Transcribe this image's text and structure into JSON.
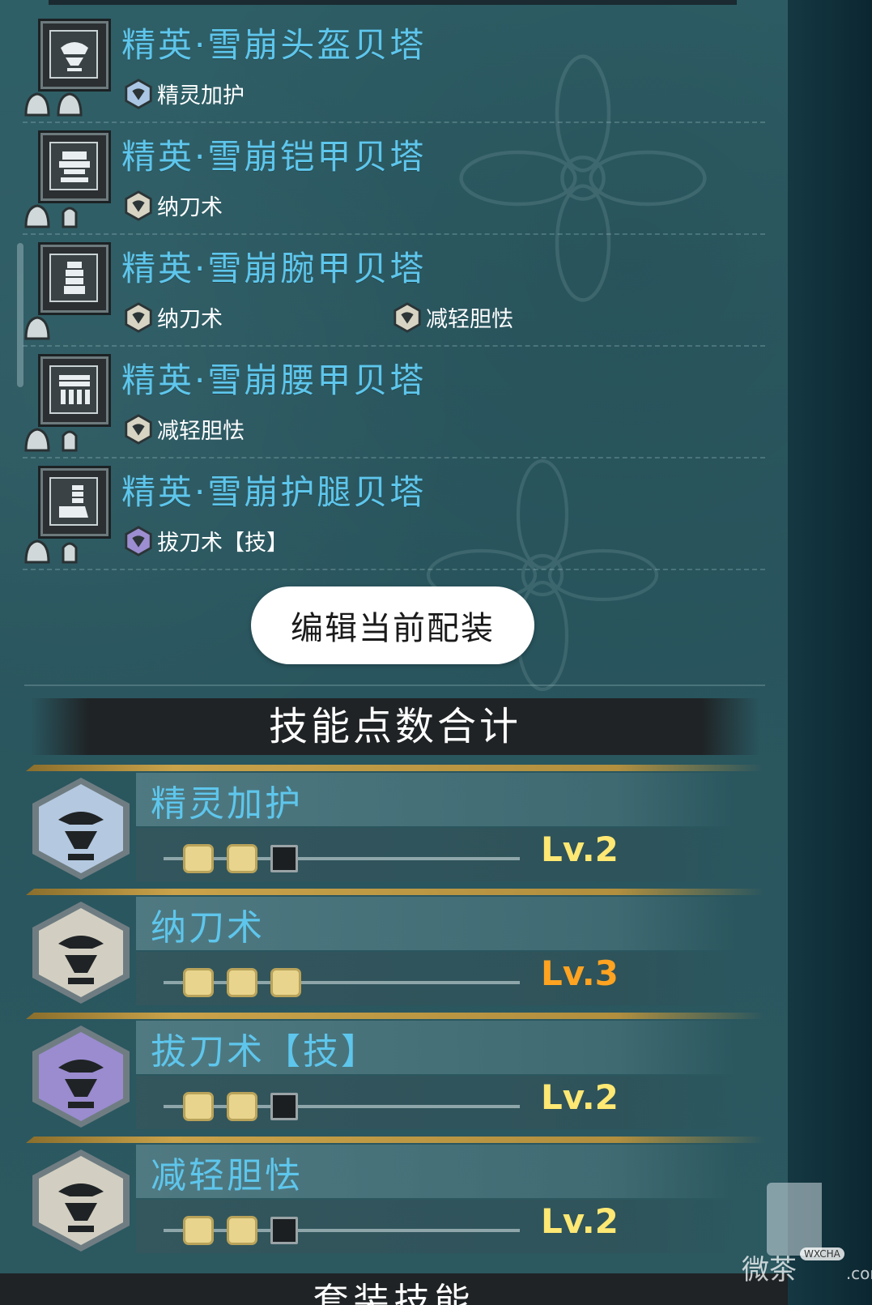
{
  "armor_list": [
    {
      "name": "精英·雪崩头盔贝塔",
      "slot_type": "helmet-icon",
      "slots": [
        "gem-slot-icon",
        "gem-slot-icon"
      ],
      "skills": [
        {
          "label": "精灵加护",
          "color": "#aac6e4"
        }
      ]
    },
    {
      "name": "精英·雪崩铠甲贝塔",
      "slot_type": "chest-armor-icon",
      "slots": [
        "gem-slot-icon",
        "small-slot-icon"
      ],
      "skills": [
        {
          "label": "纳刀术",
          "color": "#d8d4c4"
        }
      ]
    },
    {
      "name": "精英·雪崩腕甲贝塔",
      "slot_type": "gauntlet-icon",
      "slots": [
        "gem-slot-icon"
      ],
      "skills": [
        {
          "label": "纳刀术",
          "color": "#d8d4c4"
        },
        {
          "label": "减轻胆怯",
          "color": "#d8d4c4"
        }
      ]
    },
    {
      "name": "精英·雪崩腰甲贝塔",
      "slot_type": "waist-armor-icon",
      "slots": [
        "gem-slot-icon",
        "small-slot-icon"
      ],
      "skills": [
        {
          "label": "减轻胆怯",
          "color": "#d8d4c4"
        }
      ]
    },
    {
      "name": "精英·雪崩护腿贝塔",
      "slot_type": "leg-armor-icon",
      "slots": [
        "gem-slot-icon",
        "small-slot-icon"
      ],
      "skills": [
        {
          "label": "拔刀术【技】",
          "color": "#9c8ed0"
        }
      ]
    }
  ],
  "edit_button": {
    "label": "编辑当前配装"
  },
  "skill_section": {
    "title": "技能点数合计"
  },
  "skills_total": [
    {
      "name": "精灵加护",
      "level_text": "Lv.2",
      "level": 2,
      "max": 3,
      "badge_color": "#b4c8e0",
      "level_color": "#ffe873"
    },
    {
      "name": "纳刀术",
      "level_text": "Lv.3",
      "level": 3,
      "max": 3,
      "badge_color": "#d2cfc2",
      "level_color": "#ffa321"
    },
    {
      "name": "拔刀术【技】",
      "level_text": "Lv.2",
      "level": 2,
      "max": 3,
      "badge_color": "#9a8ccf",
      "level_color": "#ffe873"
    },
    {
      "name": "减轻胆怯",
      "level_text": "Lv.2",
      "level": 2,
      "max": 3,
      "badge_color": "#d2cfc2",
      "level_color": "#ffe873"
    }
  ],
  "next_section": {
    "title": "套装技能"
  },
  "watermark": {
    "text": "微茶",
    "badge": "WXCHA",
    "suffix": ".com"
  }
}
